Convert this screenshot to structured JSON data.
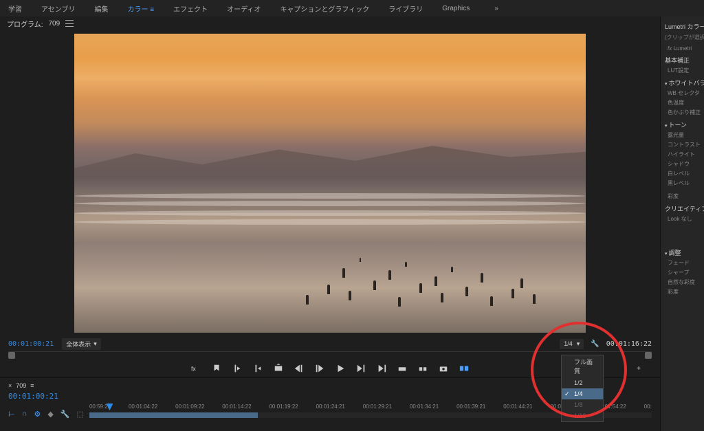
{
  "topbar": {
    "items": [
      "学習",
      "アセンブリ",
      "編集",
      "カラー",
      "エフェクト",
      "オーディオ",
      "キャプションとグラフィック",
      "ライブラリ",
      "Graphics"
    ],
    "active_index": 3
  },
  "program": {
    "label": "プログラム:",
    "name": "709"
  },
  "timecode": {
    "left": "00:01:00:21",
    "right": "00:01:16:22"
  },
  "fit_dropdown": "全体表示",
  "resolution": {
    "current": "1/4",
    "options": [
      "フル画質",
      "1/2",
      "1/4",
      "1/8",
      "1/16"
    ],
    "selected_index": 2
  },
  "timeline": {
    "tab": "709",
    "tc": "00:01:00:21",
    "times": [
      "00:59:22",
      "00:01:04:22",
      "00:01:09:22",
      "00:01:14:22",
      "00:01:19:22",
      "00:01:24:21",
      "00:01:29:21",
      "00:01:34:21",
      "00:01:39:21",
      "00:01:44:21",
      "00:01:49:21",
      "00:01:54:22",
      "00:"
    ]
  },
  "lumetri": {
    "title": "Lumetri カラー",
    "clip_none": "(クリップが選択",
    "fx_label": "Lumetri",
    "sections": {
      "basic": "基本補正",
      "lut": "LUT設定",
      "wb": "ホワイトバラ",
      "wb_items": [
        "WB セレクタ",
        "色温度",
        "色かぶり補正"
      ],
      "tone": "トーン",
      "tone_items": [
        "露光量",
        "コントラスト",
        "ハイライト",
        "シャドウ",
        "白レベル",
        "黒レベル"
      ],
      "sat": "彩度",
      "creative": "クリエイティブ",
      "look": "Look",
      "look_val": "なし",
      "adjust": "調整",
      "adjust_items": [
        "フェード",
        "シャープ",
        "自然な彩度",
        "彩度"
      ]
    }
  }
}
